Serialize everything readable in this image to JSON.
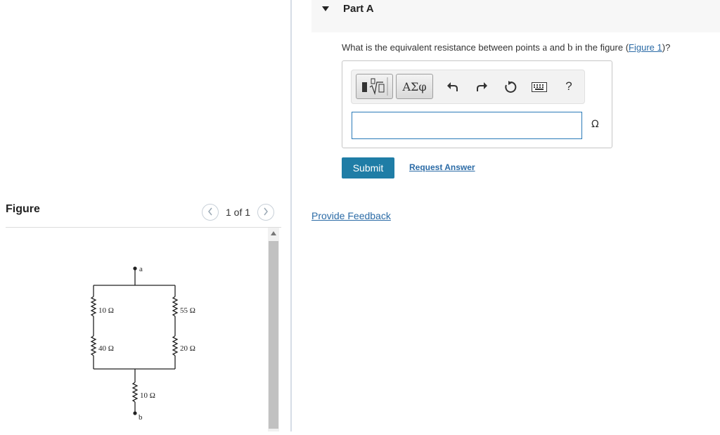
{
  "figure": {
    "title": "Figure",
    "pager": {
      "prev_icon": "chevron-left-icon",
      "text": "1 of 1",
      "next_icon": "chevron-right-icon"
    },
    "circuit": {
      "node_top": "a",
      "node_bottom": "b",
      "left_branch": [
        "10 Ω",
        "40 Ω"
      ],
      "right_branch": [
        "55 Ω",
        "20 Ω"
      ],
      "bottom_resistor": "10 Ω"
    }
  },
  "part": {
    "caret_icon": "caret-down-icon",
    "title": "Part A",
    "question": {
      "before": "What is the equivalent resistance between points ",
      "var_a": "a",
      "middle": " and ",
      "var_b": "b",
      "after_var": " in the figure (",
      "link": "Figure 1",
      "end": ")?"
    }
  },
  "toolbar": {
    "templates_icon": "templates-radical-icon",
    "symbols_label": "ΑΣφ",
    "undo_icon": "undo-icon",
    "redo_icon": "redo-icon",
    "reset_icon": "reset-icon",
    "keyboard_icon": "keyboard-icon",
    "help_label": "?"
  },
  "answer": {
    "value": "",
    "unit": "Ω"
  },
  "actions": {
    "submit": "Submit",
    "request": "Request Answer"
  },
  "feedback": {
    "link": "Provide Feedback"
  },
  "colors": {
    "accent": "#1f7da6",
    "link": "#2b6ba6",
    "input_border": "#2a7ab8"
  }
}
